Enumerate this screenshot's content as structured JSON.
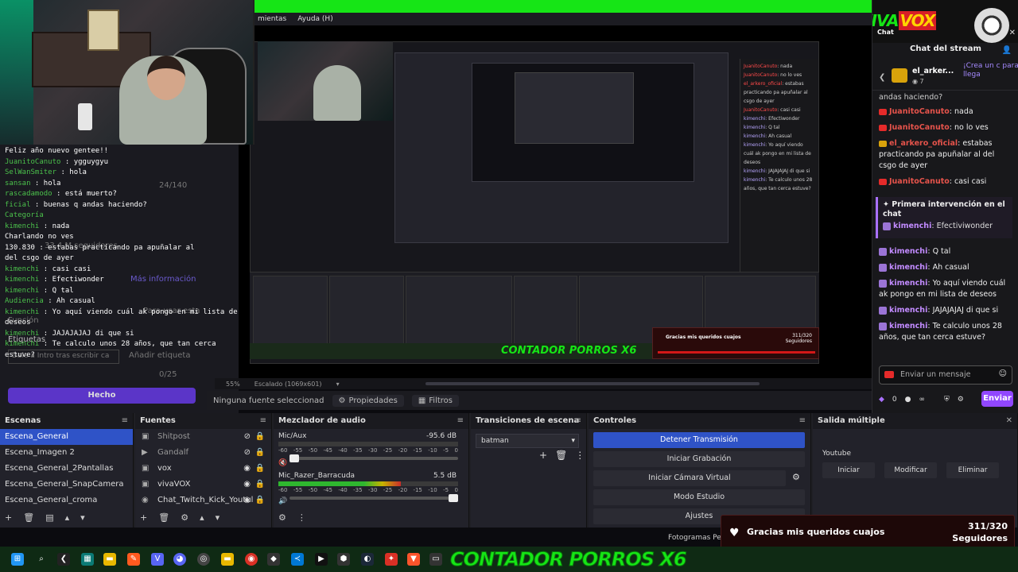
{
  "window": {
    "menu_items": [
      "mientas",
      "Ayuda (H)"
    ]
  },
  "left_preview": {
    "chat_lines": [
      {
        "user": "",
        "text": "Feliz año nuevo gentee!!"
      },
      {
        "user": "JuanitoCanuto",
        "text": " : ygguygyu"
      },
      {
        "user": "SelWanSmiter",
        "text": " : hola"
      },
      {
        "user": "sansan",
        "text": " : hola"
      },
      {
        "user": "rascadamodo",
        "text": " : está muerto?"
      },
      {
        "user": "ficial",
        "text": " : buenas q andas haciendo?"
      },
      {
        "user": "Categoría",
        "text": ""
      },
      {
        "user": "kimenchi",
        "text": " : nada"
      },
      {
        "user": "",
        "text": "Charlando  no ves"
      },
      {
        "user": "",
        "text": "130.830  : estabas practicando pa apuñalar al"
      },
      {
        "user": "",
        "text": "del csgo de ayer"
      },
      {
        "user": "kimenchi",
        "text": " : casi casi"
      },
      {
        "user": "kimenchi",
        "text": " : Efectiwonder"
      },
      {
        "user": "kimenchi",
        "text": " : Q tal"
      },
      {
        "user": "Audiencia",
        "text": " : Ah casual"
      },
      {
        "user": "kimenchi",
        "text": " : Yo aquí viendo cuál ak pongo en mi lista de"
      },
      {
        "user": "",
        "text": "deseos"
      },
      {
        "user": "kimenchi",
        "text": " : JAJAJAJAJ di que si"
      },
      {
        "user": "kimenchi",
        "text": " : Te calculo unos 28 años, que tan cerca"
      },
      {
        "user": "",
        "text": "estuve?"
      }
    ],
    "ghost_counter": "24/140",
    "ghost_more": "Más información",
    "ghost_followers": "33.4 M seguidores",
    "ghost_labels": "Etiquetas",
    "ghost_tag_placeholder": "Dale a Intro tras escribir ca",
    "ghost_add_tag": "Añadir etiqueta",
    "ghost_count2": "0/25",
    "ghost_para": "Para usar esta",
    "ghost_funcion": "Función",
    "hecho_label": "Hecho"
  },
  "preview": {
    "contador_small": "CONTADOR PORROS X6",
    "notif_title": "Gracias mis queridos cuajos",
    "notif_count": "311/320",
    "notif_sub": "Seguidores",
    "chat_lines": [
      {
        "u": "JuanitoCanuto",
        "c": "n",
        "t": ": nada"
      },
      {
        "u": "JuanitoCanuto",
        "c": "n",
        "t": ": no lo ves"
      },
      {
        "u": "el_arkero_oficial",
        "c": "n",
        "t": ": estabas practicando pa apuñalar al csgo de ayer"
      },
      {
        "u": "JuanitoCanuto",
        "c": "n",
        "t": ": casi casi"
      },
      {
        "u": "kimenchi",
        "c": "k",
        "t": ": Efectiwonder"
      },
      {
        "u": "kimenchi",
        "c": "k",
        "t": ": Q tal"
      },
      {
        "u": "kimenchi",
        "c": "k",
        "t": ": Ah casual"
      },
      {
        "u": "kimenchi",
        "c": "k",
        "t": ": Yo aquí viendo cuál ak pongo en mi lista de deseos"
      },
      {
        "u": "kimenchi",
        "c": "k",
        "t": ": JAJAJAJAJ di que si"
      },
      {
        "u": "kimenchi",
        "c": "k",
        "t": ": Te calculo unos 28 años, que tan cerca estuve?"
      }
    ]
  },
  "status": {
    "zoom": "55%",
    "scaled": "Escalado (1069x601)",
    "no_source": "Ninguna fuente seleccionad",
    "properties": "Propiedades",
    "filters": "Filtros"
  },
  "chat": {
    "brand_viva": "VIVA",
    "brand_vox": "VOX",
    "mini_label": "Chat",
    "title": "Chat del stream",
    "pinned_user": "el_arker...",
    "pinned_count": "7",
    "pinned_ad": "¡Crea un c para llega",
    "partial_top": "andas haciendo?",
    "messages": [
      {
        "badge": "n",
        "user": "JuanitoCanuto",
        "text": ": nada"
      },
      {
        "badge": "n",
        "user": "JuanitoCanuto",
        "text": ": no lo ves"
      },
      {
        "badge": "o",
        "user": "el_arkero_oficial",
        "text": ": estabas practicando pa apuñalar al del csgo de ayer"
      },
      {
        "badge": "n",
        "user": "JuanitoCanuto",
        "text": ": casi casi"
      }
    ],
    "first_title": "Primera intervención en el chat",
    "first_user": "kimenchi",
    "first_text": ": Efectiviwonder",
    "messages2": [
      {
        "user": "kimenchi",
        "text": ": Q tal"
      },
      {
        "user": "kimenchi",
        "text": ": Ah casual"
      },
      {
        "user": "kimenchi",
        "text": ": Yo aquí viendo cuál ak pongo en mi lista de deseos"
      },
      {
        "user": "kimenchi",
        "text": ": JAJAJAJAJ di que si"
      },
      {
        "user": "kimenchi",
        "text": ": Te calculo unos 28 años, que tan cerca estuve?"
      }
    ],
    "input_placeholder": "Enviar un mensaje",
    "points": "0",
    "send_label": "Enviar"
  },
  "docks": {
    "scenes": {
      "title": "Escenas",
      "items": [
        "Escena_General",
        "Escena_Imagen 2",
        "Escena_General_2Pantallas",
        "Escena_General_SnapCamera",
        "Escena_General_croma"
      ],
      "selected": 0
    },
    "sources": {
      "title": "Fuentes",
      "items": [
        {
          "name": "Shitpost",
          "icon": "▣",
          "hidden": true
        },
        {
          "name": "Gandalf",
          "icon": "▶",
          "hidden": true
        },
        {
          "name": "vox",
          "icon": "▣",
          "hidden": false
        },
        {
          "name": "vivaVOX",
          "icon": "▣",
          "hidden": false
        },
        {
          "name": "Chat_Twitch_Kick_Youtul",
          "icon": "◉",
          "hidden": false
        }
      ]
    },
    "mixer": {
      "title": "Mezclador de audio",
      "channels": [
        {
          "name": "Mic/Aux",
          "db": "-95.6 dB",
          "level": 0.0
        },
        {
          "name": "Mic_Razer_Barracuda",
          "db": "5.5 dB",
          "level": 0.68
        }
      ],
      "scale": [
        "-60",
        "-55",
        "-50",
        "-45",
        "-40",
        "-35",
        "-30",
        "-25",
        "-20",
        "-15",
        "-10",
        "-5",
        "0"
      ]
    },
    "transitions": {
      "title": "Transiciones de escena",
      "selected": "batman"
    },
    "controls": {
      "title": "Controles",
      "buttons": [
        "Detener Transmisión",
        "Iniciar Grabación",
        "Iniciar Cámara Virtual",
        "Modo Estudio",
        "Ajustes"
      ]
    },
    "multi": {
      "title": "Salida múltiple",
      "platform": "Youtube",
      "buttons": [
        "Iniciar",
        "Modificar",
        "Eliminar"
      ]
    }
  },
  "notification": {
    "title": "Gracias mis queridos cuajos",
    "count": "311/320",
    "sub": "Seguidores"
  },
  "fotogramas": "Fotogramas Pe",
  "taskbar": {
    "contador": "CONTADOR PORROS X6"
  }
}
